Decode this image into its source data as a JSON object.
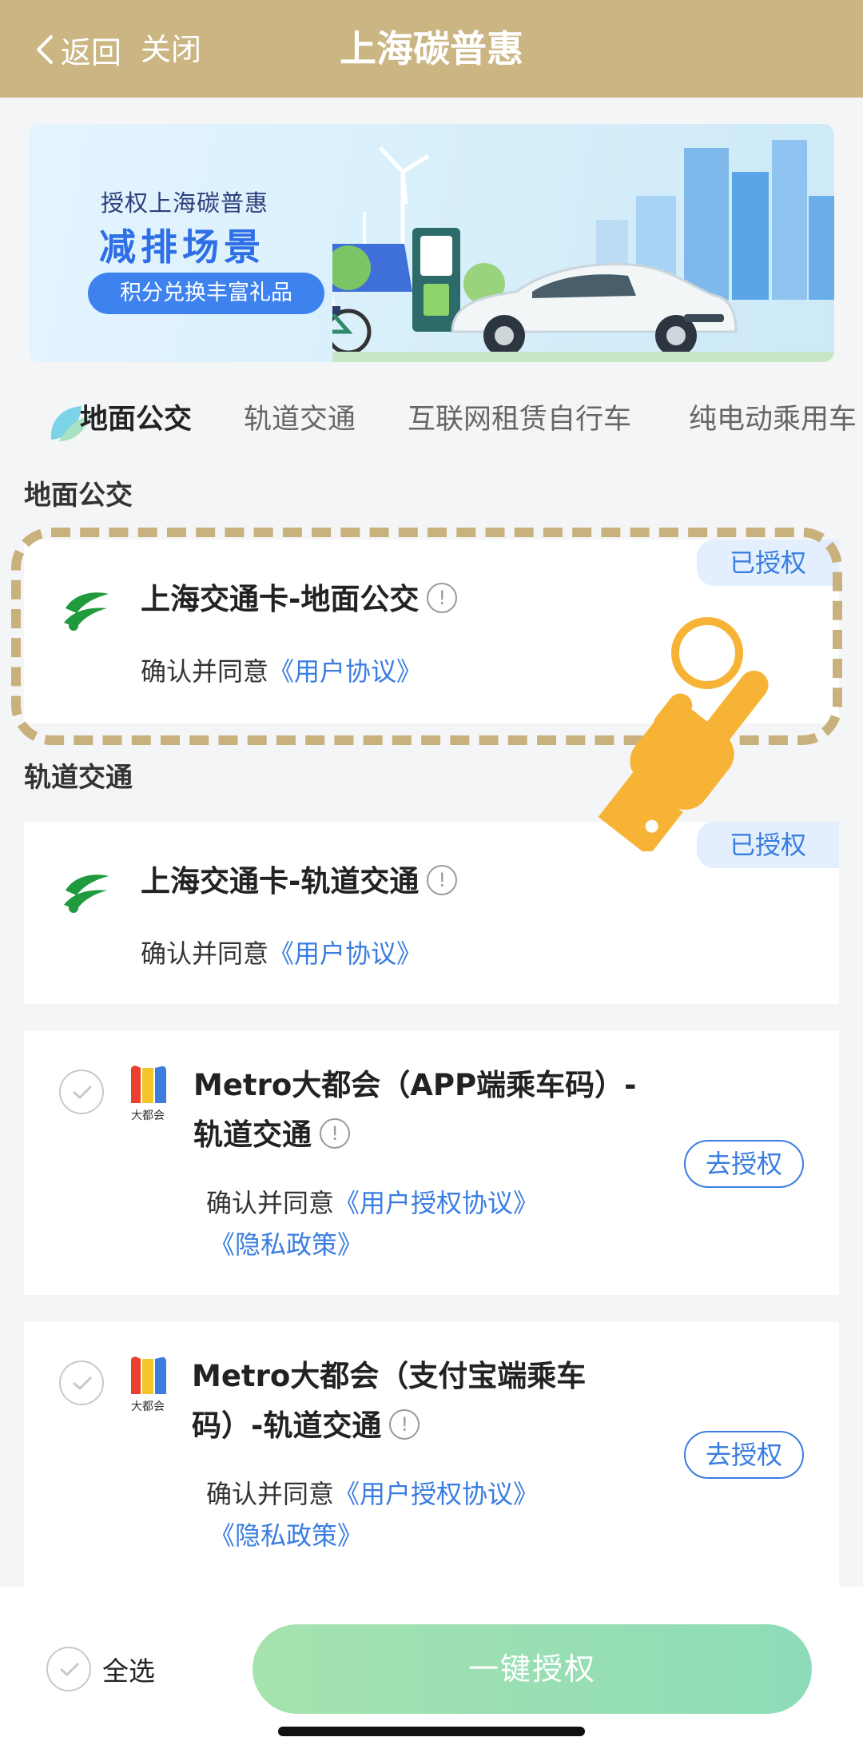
{
  "header": {
    "back_label": "返回",
    "close_label": "关闭",
    "title": "上海碳普惠"
  },
  "banner": {
    "line1": "授权上海碳普惠",
    "line2": "减排场景",
    "pill": "积分兑换丰富礼品"
  },
  "tabs": [
    {
      "label": "地面公交",
      "active": true
    },
    {
      "label": "轨道交通",
      "active": false
    },
    {
      "label": "互联网租赁自行车",
      "active": false
    },
    {
      "label": "纯电动乘用车",
      "active": false
    }
  ],
  "sections": [
    {
      "title": "地面公交",
      "cards": [
        {
          "title": "上海交通卡-地面公交",
          "logo": "shanghai-transport-card-logo",
          "status": "已授权",
          "agree_prefix": "确认并同意",
          "links": [
            "《用户协议》"
          ]
        }
      ]
    },
    {
      "title": "轨道交通",
      "cards": [
        {
          "title": "上海交通卡-轨道交通",
          "logo": "shanghai-transport-card-logo",
          "status": "已授权",
          "agree_prefix": "确认并同意",
          "links": [
            "《用户协议》"
          ]
        },
        {
          "title_line1": "Metro大都会（APP端乘车码）-",
          "title_line2": "轨道交通",
          "logo": "metro-daduhui-logo",
          "logo_text": "大都会",
          "action": "去授权",
          "agree_prefix": "确认并同意",
          "links": [
            "《用户授权协议》",
            "《隐私政策》"
          ]
        },
        {
          "title_line1": "Metro大都会（支付宝端乘车",
          "title_line2": "码）-轨道交通",
          "logo": "metro-daduhui-logo",
          "logo_text": "大都会",
          "action": "去授权",
          "agree_prefix": "确认并同意",
          "links": [
            "《用户授权协议》",
            "《隐私政策》"
          ]
        }
      ]
    }
  ],
  "footer": {
    "select_all": "全选",
    "one_key_auth": "一键授权"
  },
  "colors": {
    "header_bg": "#cab583",
    "link": "#3a7de0",
    "button_gradient_start": "#a6e3ae",
    "button_gradient_end": "#8ddbb8",
    "highlight_dash": "#c9b17d",
    "hand": "#f7b335"
  },
  "icons": [
    "chevron-left-icon",
    "info-icon",
    "check-icon",
    "leaf-icon",
    "pointing-hand-icon"
  ]
}
